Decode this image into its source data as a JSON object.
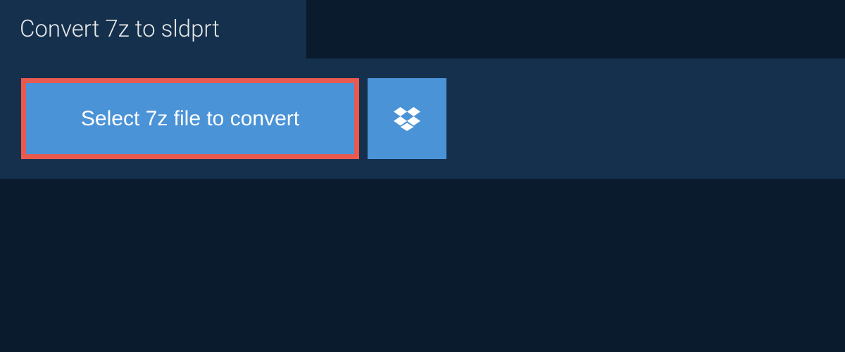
{
  "tab": {
    "title": "Convert 7z to sldprt"
  },
  "actions": {
    "select_file_label": "Select 7z file to convert"
  },
  "colors": {
    "background": "#0a1b2e",
    "panel": "#14304d",
    "button_bg": "#4b93d7",
    "highlight_border": "#e85a4f"
  }
}
